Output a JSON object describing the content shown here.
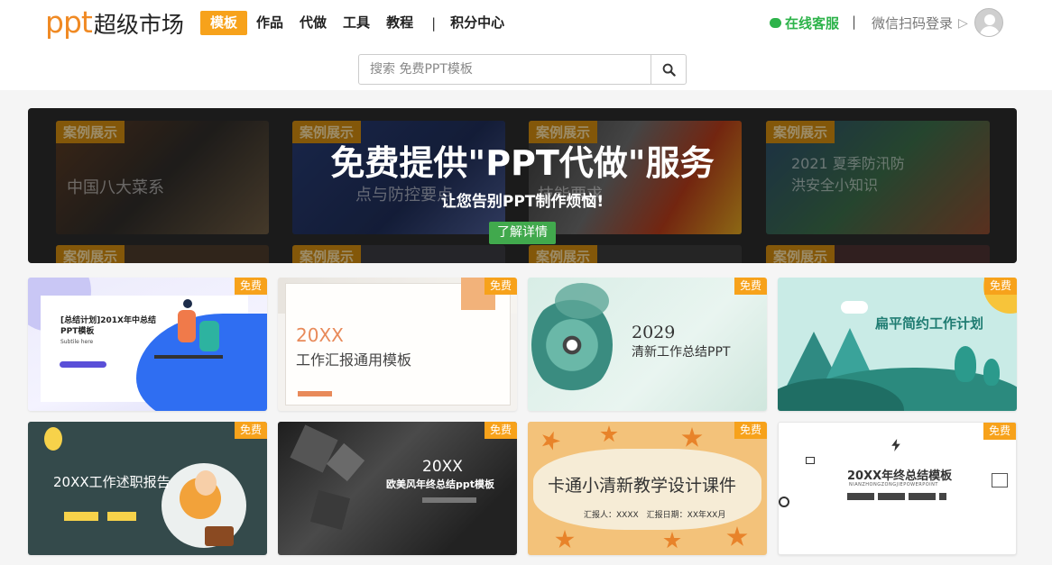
{
  "header": {
    "logo_ppt": "ppt",
    "logo_cn": "超级市场",
    "nav": [
      {
        "label": "模板",
        "active": true
      },
      {
        "label": "作品"
      },
      {
        "label": "代做"
      },
      {
        "label": "工具"
      },
      {
        "label": "教程"
      }
    ],
    "nav_separator": "|",
    "nav_points": "积分中心",
    "service": "在线客服",
    "separator": "|",
    "login": "微信扫码登录",
    "login_arrow": "▷",
    "accent_color": "#f7a21b",
    "service_color": "#2db34a"
  },
  "search": {
    "placeholder": "搜索 免费PPT模板"
  },
  "banner": {
    "title": "免费提供\"PPT代做\"服务",
    "subtitle": "让您告别PPT制作烦恼!",
    "button": "了解详情",
    "bg_tag": "案例展示",
    "bg_cards": [
      {
        "text": "中国八大菜系"
      },
      {
        "text": "点与防控要点"
      },
      {
        "text": "技能要求"
      },
      {
        "text": "2021 夏季防汛防洪安全小知识"
      }
    ]
  },
  "templates": [
    {
      "badge": "免费",
      "title": "[总结计划]201X年中总结PPT模板",
      "subtitle": "Subtile here"
    },
    {
      "badge": "免费",
      "title": "20XX",
      "subtitle": "工作汇报通用模板"
    },
    {
      "badge": "免费",
      "title": "2029",
      "subtitle": "清新工作总结PPT"
    },
    {
      "badge": "免费",
      "title": "扁平简约工作计划",
      "subtitle": ""
    },
    {
      "badge": "免费",
      "title": "20XX工作述职报告",
      "subtitle": ""
    },
    {
      "badge": "免费",
      "title": "20XX",
      "subtitle": "欧美风年终总结ppt模板"
    },
    {
      "badge": "免费",
      "title": "卡通小清新教学设计课件",
      "subtitle": "汇报人：XXXX　汇报日期：XX年XX月"
    },
    {
      "badge": "免费",
      "title": "20XX年终总结模板",
      "subtitle": "NIANZHONGZONGJIEPOWERPOINT"
    }
  ]
}
